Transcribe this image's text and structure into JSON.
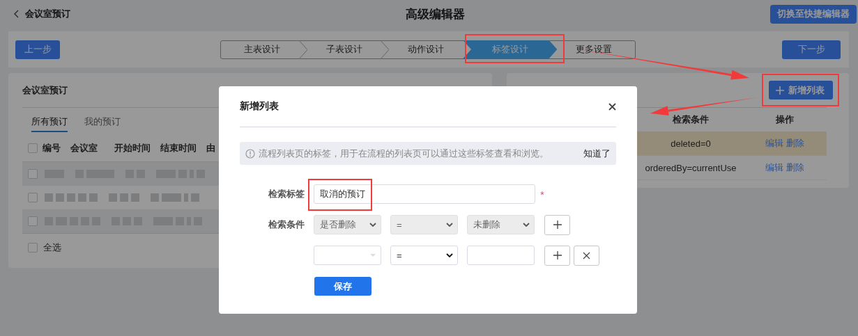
{
  "header": {
    "back_label": "会议室预订",
    "title": "高级编辑器",
    "switch_button": "切换至快捷编辑器"
  },
  "steps_bar": {
    "prev_button": "上一步",
    "next_button": "下一步",
    "steps": [
      {
        "label": "主表设计",
        "selected": false
      },
      {
        "label": "子表设计",
        "selected": false
      },
      {
        "label": "动作设计",
        "selected": false
      },
      {
        "label": "标签设计",
        "selected": true
      },
      {
        "label": "更多设置",
        "selected": false
      }
    ]
  },
  "bookings_panel": {
    "title": "会议室预订",
    "tabs": [
      {
        "label": "所有预订",
        "selected": true
      },
      {
        "label": "我的预订",
        "selected": false
      }
    ],
    "table": {
      "header_checked": false,
      "columns": [
        "编号",
        "会议室",
        "开始时间",
        "结束时间",
        "由"
      ],
      "rows": [
        {
          "checked": false,
          "shaded": true
        },
        {
          "checked": false,
          "shaded": false
        },
        {
          "checked": false,
          "shaded": true
        }
      ]
    },
    "select_all": {
      "label": "全选",
      "checked": false
    }
  },
  "list_panel": {
    "add_button": "新增列表",
    "columns": [
      "检索条件",
      "操作"
    ],
    "rows": [
      {
        "condition": "deleted=0",
        "actions": [
          "编辑",
          "删除"
        ],
        "highlighted": true
      },
      {
        "condition": "orderedBy=currentUse",
        "actions": [
          "编辑",
          "删除"
        ],
        "highlighted": false
      }
    ]
  },
  "dialog": {
    "title": "新增列表",
    "notice": {
      "text": "流程列表页的标签，用于在流程的列表页可以通过这些标签查看和浏览。",
      "dismiss": "知道了"
    },
    "tag_field": {
      "label": "检索标签",
      "value": "取消的预订",
      "required_mark": "*"
    },
    "conditions": {
      "label": "检索条件",
      "rows": [
        {
          "field": {
            "kind": "select",
            "value": "是否删除",
            "disabled": true
          },
          "operator": {
            "kind": "select",
            "value": "=",
            "disabled": true
          },
          "value": {
            "kind": "select",
            "value": "未删除",
            "disabled": true
          },
          "removable": false
        },
        {
          "field": {
            "kind": "select",
            "disabled": false
          },
          "operator": {
            "kind": "select",
            "value": "=",
            "disabled": false
          },
          "value": {
            "kind": "input",
            "disabled": false
          },
          "removable": true
        }
      ]
    },
    "save_button": "保存"
  }
}
